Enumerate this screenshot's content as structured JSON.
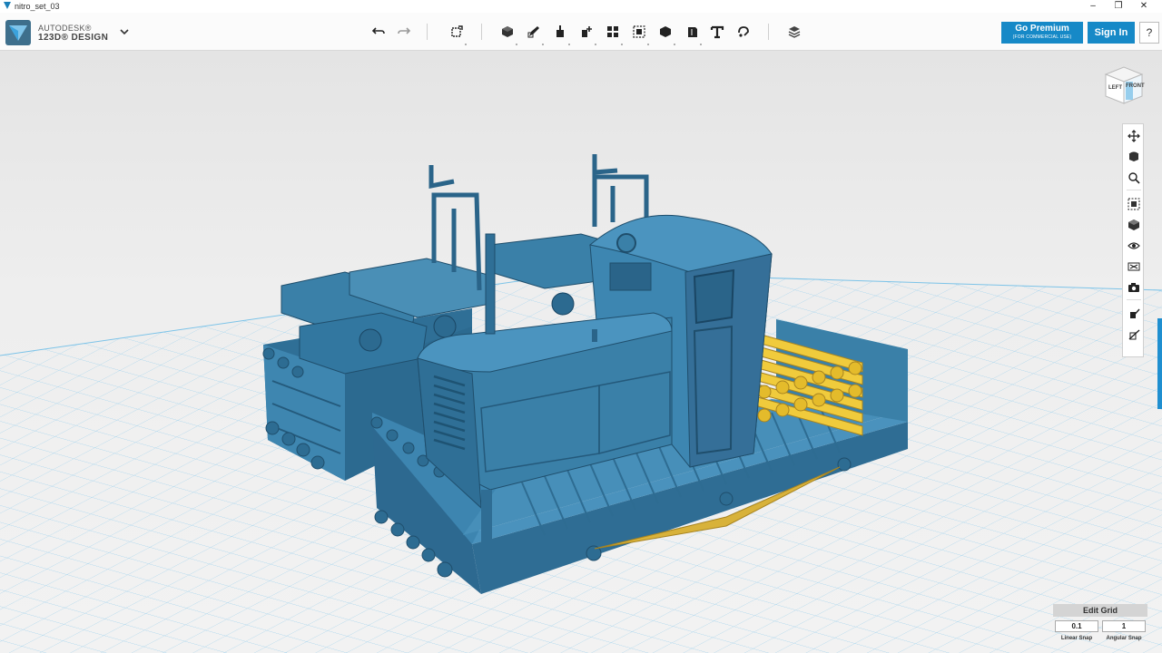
{
  "window": {
    "title": "nitro_set_03",
    "minimize_icon": "minimize-icon",
    "maximize_icon": "restore-icon",
    "close_icon": "close-icon"
  },
  "brand": {
    "company": "AUTODESK®",
    "product": "123D® DESIGN"
  },
  "toolbar": {
    "undo": "undo-icon",
    "redo": "redo-icon",
    "tools": [
      "transform",
      "primitives",
      "sketch",
      "construct",
      "modify",
      "pattern",
      "grouping",
      "combine",
      "measure",
      "text",
      "snap",
      "material"
    ]
  },
  "premium": {
    "label": "Go Premium",
    "sublabel": "(FOR COMMERCIAL USE)"
  },
  "signin": {
    "label": "Sign In"
  },
  "help": {
    "label": "?"
  },
  "viewcube": {
    "left": "LEFT",
    "front": "FRONT"
  },
  "navbar": [
    "pan",
    "orbit",
    "zoom",
    "fit",
    "views",
    "visibility",
    "materials-outlines",
    "screenshot",
    "solid-edit",
    "hide-all"
  ],
  "grid": {
    "title": "Edit Grid",
    "linear_value": "0.1",
    "angular_value": "1",
    "linear_label": "Linear Snap",
    "angular_label": "Angular Snap"
  },
  "colors": {
    "accent": "#1689c7",
    "model_blue": "#3a80a8",
    "model_yellow": "#e8c23a",
    "grid_line": "#9fd2ee"
  }
}
